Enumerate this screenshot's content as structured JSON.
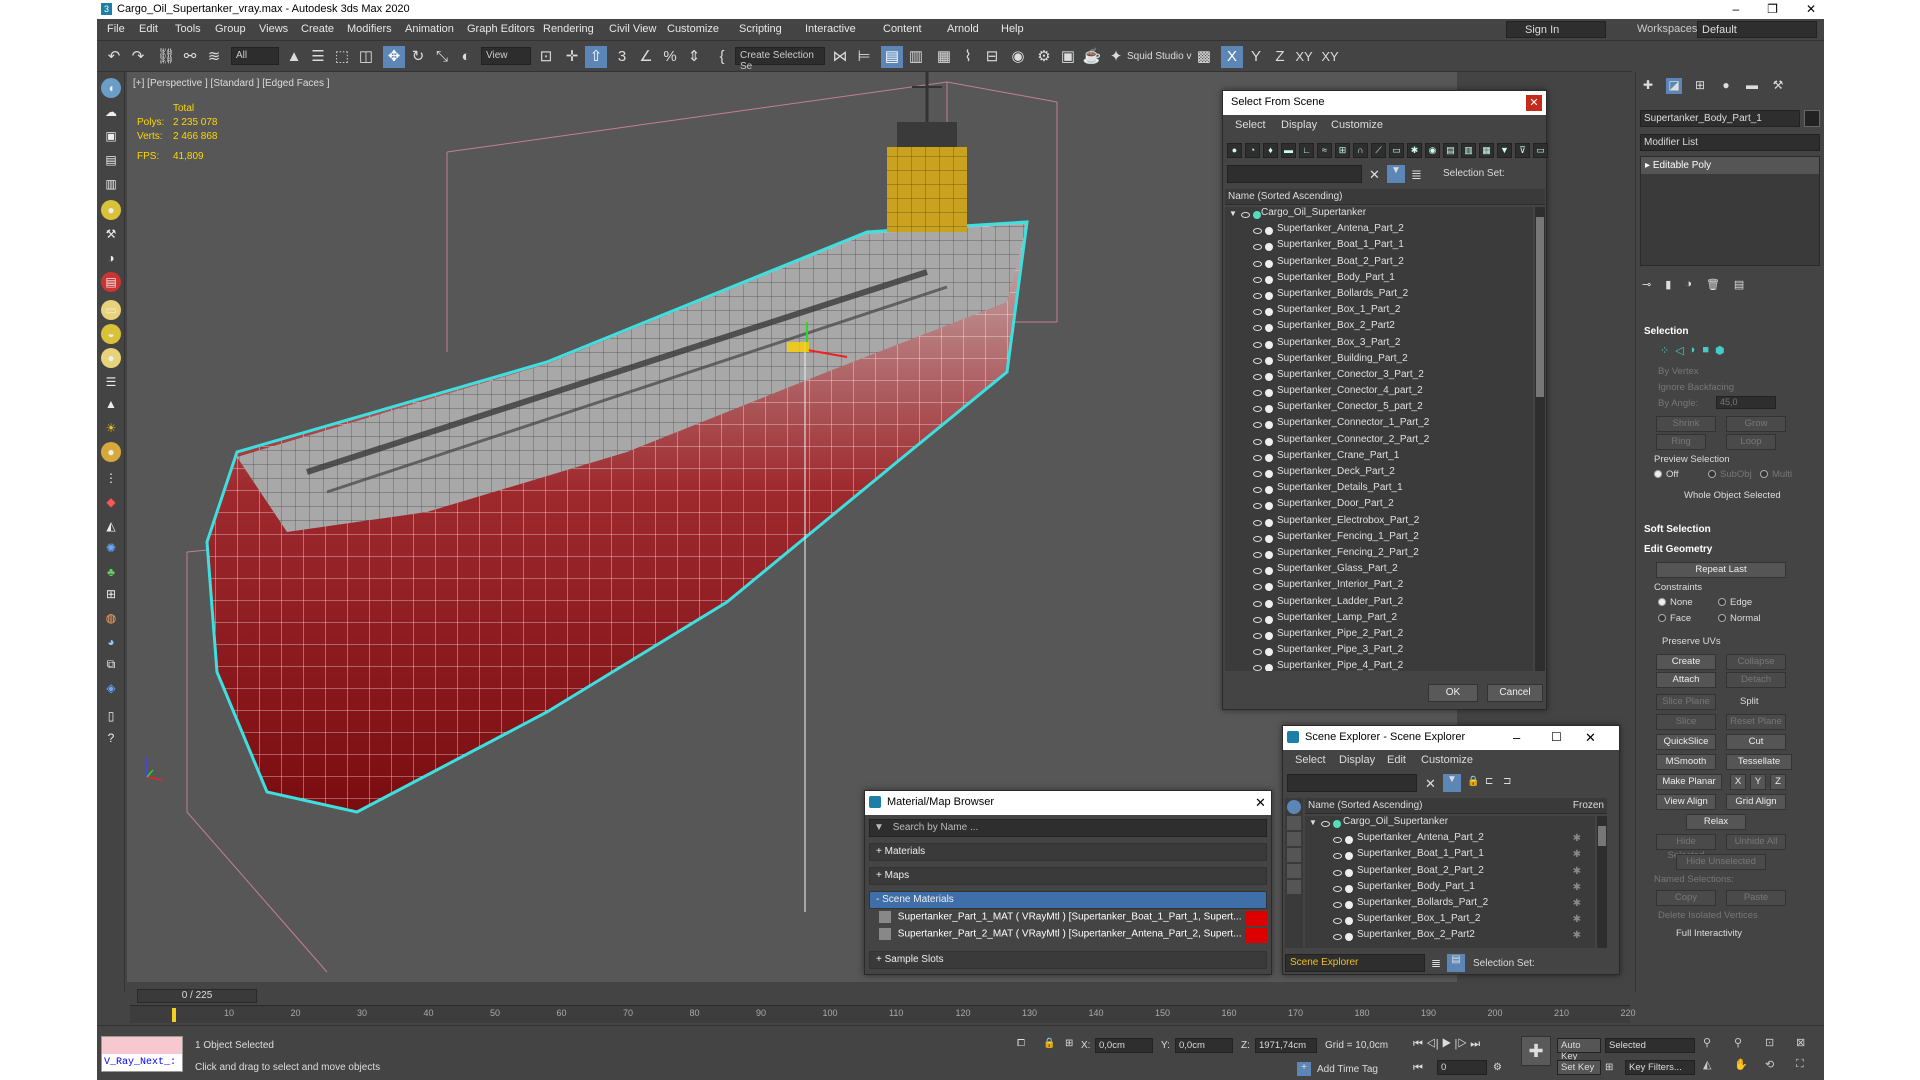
{
  "window": {
    "title": "Cargo_Oil_Supertanker_vray.max - Autodesk 3ds Max 2020",
    "min": "–",
    "max": "❐",
    "close": "✕"
  },
  "menu": [
    "File",
    "Edit",
    "Tools",
    "Group",
    "Views",
    "Create",
    "Modifiers",
    "Animation",
    "Graph Editors",
    "Rendering",
    "Civil View",
    "Customize",
    "Scripting",
    "Interactive",
    "Content",
    "Arnold",
    "Help"
  ],
  "signin": "Sign In",
  "workspaces": {
    "label": "Workspaces:",
    "value": "Default"
  },
  "toolbar": {
    "filter": "All",
    "refcoord": "View",
    "selset": "Create Selection Se",
    "squid": "Squid Studio v",
    "axes": [
      "X",
      "Y",
      "Z",
      "XY",
      "XY"
    ]
  },
  "viewport": {
    "label": "[+] [Perspective ] [Standard ] [Edged Faces ]",
    "stats": {
      "total": "Total",
      "polys_label": "Polys:",
      "polys": "2 235 078",
      "verts_label": "Verts:",
      "verts": "2 466 868",
      "fps_label": "FPS:",
      "fps": "41,809"
    }
  },
  "select_from_scene": {
    "title": "Select From Scene",
    "menu": [
      "Select",
      "Display",
      "Customize"
    ],
    "selection_set": "Selection Set:",
    "col": "Name (Sorted Ascending)",
    "root": "Cargo_Oil_Supertanker",
    "items": [
      "Supertanker_Antena_Part_2",
      "Supertanker_Boat_1_Part_1",
      "Supertanker_Boat_2_Part_2",
      "Supertanker_Body_Part_1",
      "Supertanker_Bollards_Part_2",
      "Supertanker_Box_1_Part_2",
      "Supertanker_Box_2_Part2",
      "Supertanker_Box_3_Part_2",
      "Supertanker_Building_Part_2",
      "Supertanker_Conector_3_Part_2",
      "Supertanker_Conector_4_part_2",
      "Supertanker_Conector_5_part_2",
      "Supertanker_Connector_1_Part_2",
      "Supertanker_Connector_2_Part_2",
      "Supertanker_Crane_Part_1",
      "Supertanker_Deck_Part_2",
      "Supertanker_Details_Part_1",
      "Supertanker_Door_Part_2",
      "Supertanker_Electrobox_Part_2",
      "Supertanker_Fencing_1_Part_2",
      "Supertanker_Fencing_2_Part_2",
      "Supertanker_Glass_Part_2",
      "Supertanker_Interior_Part_2",
      "Supertanker_Ladder_Part_2",
      "Supertanker_Lamp_Part_2",
      "Supertanker_Pipe_2_Part_2",
      "Supertanker_Pipe_3_Part_2",
      "Supertanker_Pipe_4_Part_2"
    ],
    "ok": "OK",
    "cancel": "Cancel"
  },
  "scene_explorer": {
    "title": "Scene Explorer - Scene Explorer",
    "menu": [
      "Select",
      "Display",
      "Edit",
      "Customize"
    ],
    "col": "Name (Sorted Ascending)",
    "frozen": "Frozen",
    "root": "Cargo_Oil_Supertanker",
    "items": [
      "Supertanker_Antena_Part_2",
      "Supertanker_Boat_1_Part_1",
      "Supertanker_Boat_2_Part_2",
      "Supertanker_Body_Part_1",
      "Supertanker_Bollards_Part_2",
      "Supertanker_Box_1_Part_2",
      "Supertanker_Box_2_Part2"
    ],
    "footer": "Scene Explorer",
    "selection_set": "Selection Set:"
  },
  "material_browser": {
    "title": "Material/Map Browser",
    "search": "Search by Name ...",
    "groups": [
      "+ Materials",
      "+ Maps",
      "- Scene Materials",
      "+ Sample Slots"
    ],
    "materials": [
      "Supertanker_Part_1_MAT  ( VRayMtl )  [Supertanker_Boat_1_Part_1, Supert...",
      "Supertanker_Part_2_MAT  ( VRayMtl )  [Supertanker_Antena_Part_2, Supert..."
    ]
  },
  "command_panel": {
    "object_name": "Supertanker_Body_Part_1",
    "modifier_list": "Modifier List",
    "stack": "Editable Poly",
    "selection": "Selection",
    "by_vertex": "By Vertex",
    "ignore_backfacing": "Ignore Backfacing",
    "by_angle": "By Angle:",
    "angle": "45,0",
    "shrink": "Shrink",
    "grow": "Grow",
    "ring": "Ring",
    "loop": "Loop",
    "preview_selection": "Preview Selection",
    "off": "Off",
    "subobj": "SubObj",
    "multi": "Multi",
    "whole_object": "Whole Object Selected",
    "soft_selection": "Soft Selection",
    "edit_geometry": "Edit Geometry",
    "repeat_last": "Repeat Last",
    "constraints": "Constraints",
    "none": "None",
    "edge": "Edge",
    "face": "Face",
    "normal": "Normal",
    "preserve_uvs": "Preserve UVs",
    "create": "Create",
    "collapse": "Collapse",
    "attach": "Attach",
    "detach": "Detach",
    "slice_plane": "Slice Plane",
    "split": "Split",
    "slice": "Slice",
    "reset_plane": "Reset Plane",
    "quickslice": "QuickSlice",
    "cut": "Cut",
    "msmooth": "MSmooth",
    "tessellate": "Tessellate",
    "make_planar": "Make Planar",
    "x": "X",
    "y": "Y",
    "z": "Z",
    "view_align": "View Align",
    "grid_align": "Grid Align",
    "relax": "Relax",
    "hide_selected": "Hide Selected",
    "unhide_all": "Unhide All",
    "hide_unselected": "Hide Unselected",
    "named_selections": "Named Selections:",
    "copy": "Copy",
    "paste": "Paste",
    "delete_isolated": "Delete Isolated Vertices",
    "full_interactivity": "Full Interactivity"
  },
  "timeline": {
    "frame": "0 / 225",
    "ticks": [
      "10",
      "20",
      "30",
      "40",
      "50",
      "60",
      "70",
      "80",
      "90",
      "100",
      "110",
      "120",
      "130",
      "140",
      "150",
      "160",
      "170",
      "180",
      "190",
      "200",
      "210",
      "220"
    ]
  },
  "status": {
    "maxscript": "V_Ray_Next_:",
    "selected": "1 Object Selected",
    "prompt": "Click and drag to select and move objects",
    "x_label": "X:",
    "x": "0,0cm",
    "y_label": "Y:",
    "y": "0,0cm",
    "z_label": "Z:",
    "z": "1971,74cm",
    "grid": "Grid = 10,0cm",
    "add_time_tag": "Add Time Tag",
    "auto_key": "Auto Key",
    "set_key": "Set Key",
    "selected_drop": "Selected",
    "key_filters": "Key Filters...",
    "frame": "0"
  },
  "colors": {
    "hull_red": "#8e1116",
    "wire_cyan": "#3de0e0",
    "selection_yellow": "#ffd700",
    "ui_bg": "#444444",
    "accent": "#5b86b5"
  }
}
